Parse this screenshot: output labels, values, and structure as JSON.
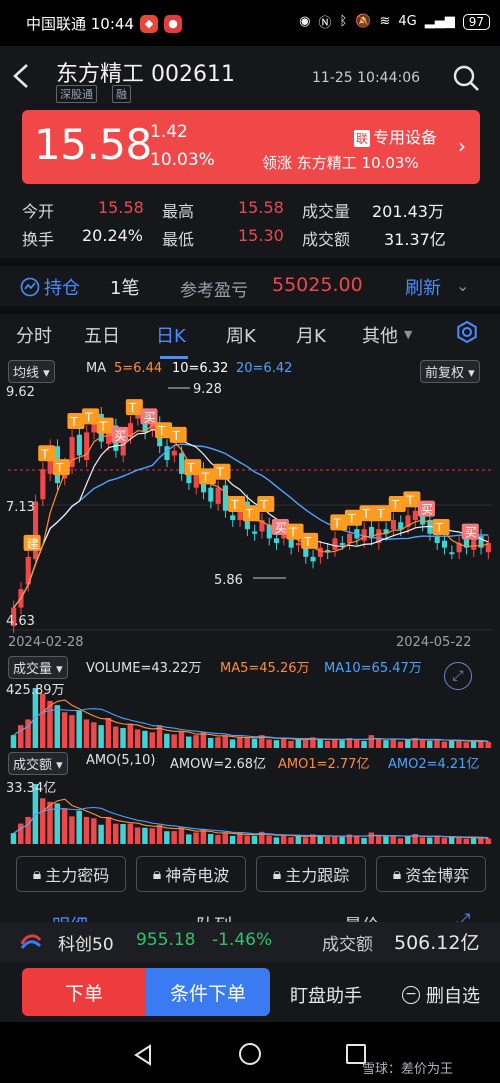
{
  "status_bar": {
    "carrier_time": "中国联通 10:44",
    "network": "4G",
    "battery": "97"
  },
  "header": {
    "title": "东方精工 002611",
    "tags": [
      "深股通",
      "融"
    ],
    "datetime": "11-25 10:44:06"
  },
  "quote": {
    "price": "15.58",
    "change": "1.42",
    "change_pct": "10.03%",
    "sector_badge": "联",
    "sector": "专用设备",
    "leader": "领涨 东方精工 10.03%"
  },
  "stats": [
    {
      "label": "今开",
      "value": "15.58",
      "color": "#f04848"
    },
    {
      "label": "最高",
      "value": "15.58",
      "color": "#f04848"
    },
    {
      "label": "成交量",
      "value": "201.43万",
      "color": "#f2f2f2"
    },
    {
      "label": "换手",
      "value": "20.24%",
      "color": "#f2f2f2"
    },
    {
      "label": "最低",
      "value": "15.30",
      "color": "#f04848"
    },
    {
      "label": "成交额",
      "value": "31.37亿",
      "color": "#f2f2f2"
    }
  ],
  "position": {
    "label": "持仓",
    "count": "1笔",
    "pnl_label": "参考盈亏",
    "pnl_value": "55025.00",
    "refresh": "刷新"
  },
  "tabs": [
    "分时",
    "五日",
    "日K",
    "周K",
    "月K",
    "其他"
  ],
  "active_tab": "日K",
  "kline": {
    "ma_select": "均线",
    "ma_label": "MA",
    "ma5": "5=6.44",
    "ma10": "10=6.32",
    "ma20": "20=6.42",
    "adjust": "前复权",
    "y_high": "9.62",
    "y_mid": "7.13",
    "y_low": "4.63",
    "peak": "9.28",
    "trough": "5.86",
    "date_start": "2024-02-28",
    "date_end": "2024-05-22",
    "marker_jian": "建",
    "marker_t": "T",
    "marker_buy": "买",
    "colors": {
      "up": "#f04848",
      "down": "#3fd3d3",
      "ma5": "#ff8c3a",
      "ma10": "#ffffff",
      "ma20": "#4aa3ff",
      "marker": "#ff9b21"
    }
  },
  "volume": {
    "select": "成交量",
    "main": "VOLUME=43.22万",
    "ma5": "MA5=45.26万",
    "ma10": "MA10=65.47万",
    "max": "425.89万"
  },
  "amount": {
    "select": "成交额",
    "main": "AMO(5,10)",
    "amow": "AMOW=2.68亿",
    "amo1": "AMO1=2.77亿",
    "amo2": "AMO2=4.21亿",
    "max": "33.34亿"
  },
  "lock_buttons": [
    "主力密码",
    "神奇电波",
    "主力跟踪",
    "资金博弈"
  ],
  "section_tabs": [
    "明细",
    "队列",
    "量价"
  ],
  "index_bar": {
    "name": "科创50",
    "value": "955.18",
    "change": "-1.46%",
    "turnover_label": "成交额",
    "turnover": "506.12亿"
  },
  "actions": {
    "order": "下单",
    "cond_order": "条件下单",
    "helper": "盯盘助手",
    "remove": "删自选"
  },
  "watermark": "雪球：差价为王"
}
